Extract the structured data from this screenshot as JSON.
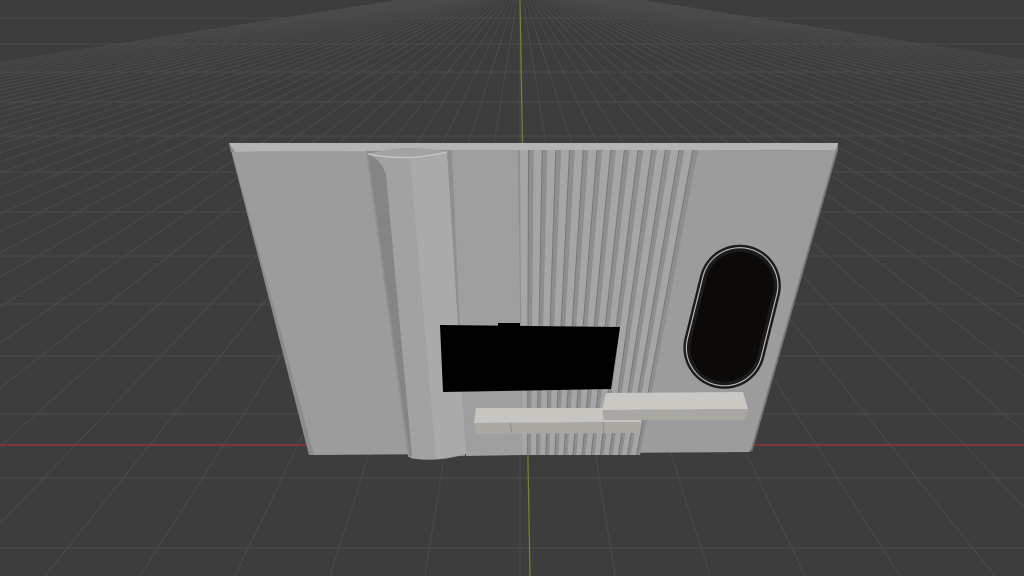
{
  "viewport": {
    "background_color": "#3d3d3d",
    "grid_color": "#4a4a4a",
    "x_axis_color": "#8a3a3a",
    "y_axis_color": "#6f8a2a"
  },
  "model": {
    "panel_front_color": "#9d9d9d",
    "panel_top_color": "#b4b4b4",
    "panel_side_color": "#7f7f7f",
    "ribs_count": 13,
    "window_color": "#0b0a09",
    "window_rim_color": "#1a1a1a",
    "occluder_color": "#000000",
    "slider_color": "#b9b8b3"
  }
}
